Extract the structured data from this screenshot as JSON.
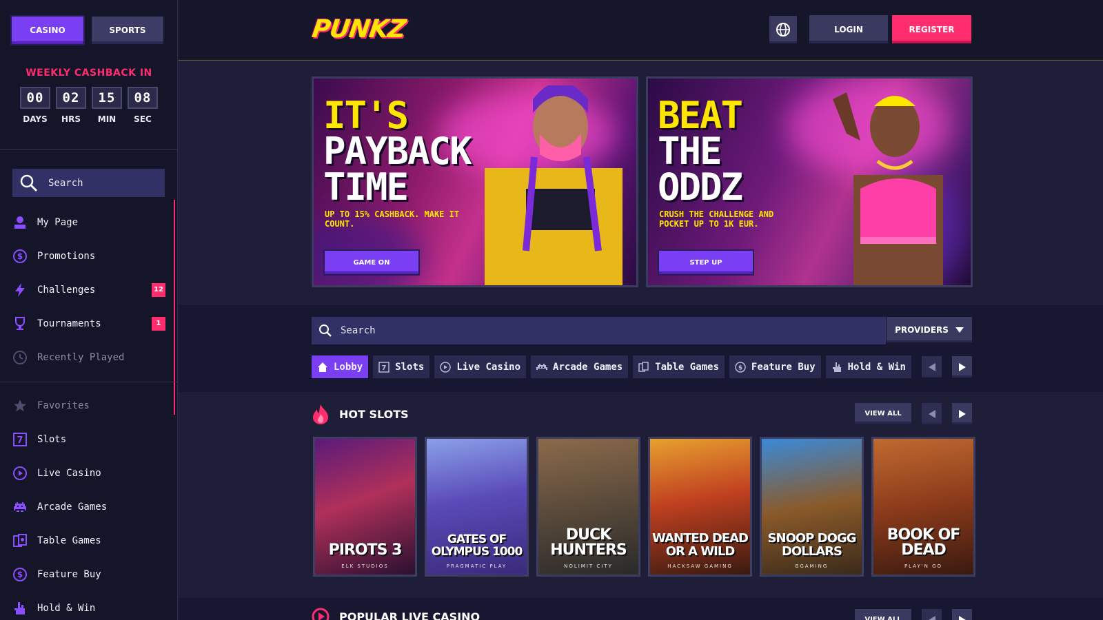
{
  "sidebar": {
    "mode_tabs": [
      "CASINO",
      "SPORTS"
    ],
    "cashback": {
      "title": "WEEKLY CASHBACK IN",
      "units": [
        {
          "value": "00",
          "label": "DAYS"
        },
        {
          "value": "02",
          "label": "HRS"
        },
        {
          "value": "15",
          "label": "MIN"
        },
        {
          "value": "08",
          "label": "SEC"
        }
      ]
    },
    "search_placeholder": "Search",
    "nav_primary": [
      {
        "label": "My Page",
        "icon": "user-icon"
      },
      {
        "label": "Promotions",
        "icon": "dollar-coin-icon"
      },
      {
        "label": "Challenges",
        "icon": "lightning-icon",
        "badge": "12"
      },
      {
        "label": "Tournaments",
        "icon": "trophy-icon",
        "badge": "1"
      },
      {
        "label": "Recently Played",
        "icon": "clock-icon"
      }
    ],
    "nav_secondary": [
      {
        "label": "Favorites",
        "icon": "star-icon"
      },
      {
        "label": "Slots",
        "icon": "slot-seven-icon"
      },
      {
        "label": "Live Casino",
        "icon": "play-circle-icon"
      },
      {
        "label": "Arcade Games",
        "icon": "space-invader-icon"
      },
      {
        "label": "Table Games",
        "icon": "cards-icon"
      },
      {
        "label": "Feature Buy",
        "icon": "dollar-coin-icon"
      },
      {
        "label": "Hold & Win",
        "icon": "hand-pointer-icon"
      }
    ]
  },
  "header": {
    "logo": "PUNKZ",
    "login_label": "LOGIN",
    "register_label": "REGISTER"
  },
  "banners": [
    {
      "title_yellow": "IT'S",
      "title_white_1": "PAYBACK",
      "title_white_2": "TIME",
      "subtitle": "UP TO 15% CASHBACK. MAKE IT COUNT.",
      "cta": "GAME ON"
    },
    {
      "title_yellow": "BEAT",
      "title_white_1": "THE",
      "title_white_2": "ODDZ",
      "subtitle": "CRUSH THE CHALLENGE AND POCKET UP TO 1K EUR.",
      "cta": "STEP UP"
    }
  ],
  "lobby": {
    "search_placeholder": "Search",
    "providers_label": "PROVIDERS",
    "categories": [
      {
        "label": "Lobby",
        "icon": "home-icon"
      },
      {
        "label": "Slots",
        "icon": "slot-seven-icon"
      },
      {
        "label": "Live Casino",
        "icon": "play-circle-icon"
      },
      {
        "label": "Arcade Games",
        "icon": "space-invader-icon"
      },
      {
        "label": "Table Games",
        "icon": "cards-icon"
      },
      {
        "label": "Feature Buy",
        "icon": "dollar-coin-icon"
      },
      {
        "label": "Hold & Win",
        "icon": "hand-pointer-icon"
      }
    ]
  },
  "hot_slots": {
    "title": "HOT SLOTS",
    "view_all": "VIEW ALL",
    "games": [
      {
        "name": "PIROTS 3",
        "studio": "ELK STUDIOS"
      },
      {
        "name": "GATES OF OLYMPUS 1000",
        "studio": "PRAGMATIC PLAY"
      },
      {
        "name": "DUCK HUNTERS",
        "studio": "NOLIMIT CITY"
      },
      {
        "name": "WANTED DEAD OR A WILD",
        "studio": "HACKSAW GAMING"
      },
      {
        "name": "SNOOP DOGG DOLLARS",
        "studio": "BGAMING"
      },
      {
        "name": "BOOK OF DEAD",
        "studio": "PLAY'N GO"
      }
    ]
  },
  "popular_live": {
    "title": "POPULAR LIVE CASINO",
    "view_all": "VIEW ALL"
  },
  "colors": {
    "accent_purple": "#7a3ff2",
    "accent_pink": "#ff2d6e",
    "logo_yellow": "#ffe600",
    "bg_main": "#1f1e38",
    "bg_sidebar": "#15152a"
  }
}
